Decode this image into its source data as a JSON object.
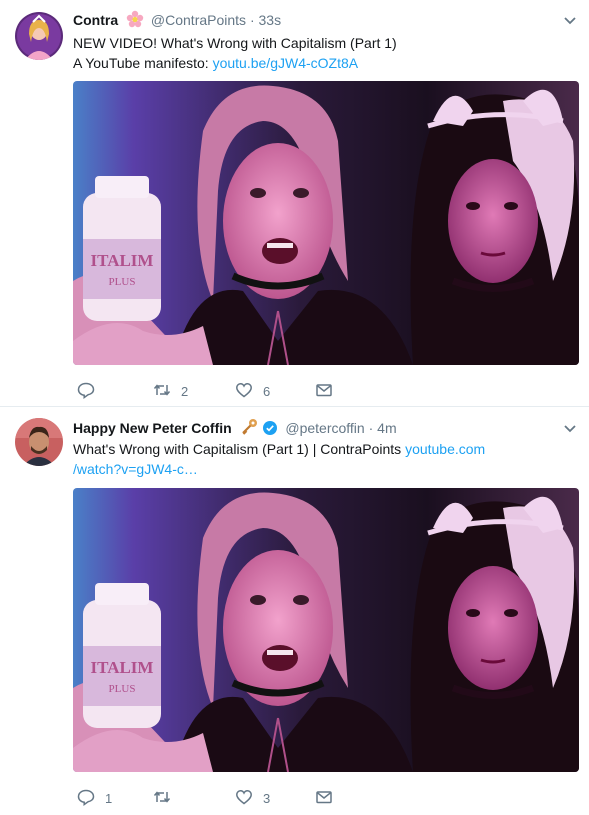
{
  "tweets": [
    {
      "display_name": "Contra",
      "name_badge_icon": "flower-emoji",
      "handle": "@ContraPoints",
      "separator": "·",
      "time": "33s",
      "text_line1": "NEW VIDEO! What's Wrong with Capitalism (Part 1)",
      "text_line2_prefix": "A YouTube manifesto: ",
      "link_text": "youtu.be/gJW4-cOZt8A",
      "media_bottle_text": "ITALIM",
      "media_bottle_subtext": "PLUS",
      "reply_count": "",
      "retweet_count": "2",
      "like_count": "6"
    },
    {
      "display_name": "Happy New Peter Coffin",
      "name_badge_icon": "key-emoji",
      "verified_icon": "verified-badge",
      "handle": "@petercoffin",
      "separator": "·",
      "time": "4m",
      "text_line1_prefix": "What's Wrong with Capitalism (Part 1) | ContraPoints ",
      "link_text_a": "youtube.com",
      "link_text_b": "/watch?v=gJW4-c…",
      "media_bottle_text": "ITALIM",
      "media_bottle_subtext": "PLUS",
      "reply_count": "1",
      "retweet_count": "",
      "like_count": "3"
    }
  ],
  "colors": {
    "link": "#1da1f2",
    "muted": "#657786",
    "verified": "#1da1f2"
  }
}
